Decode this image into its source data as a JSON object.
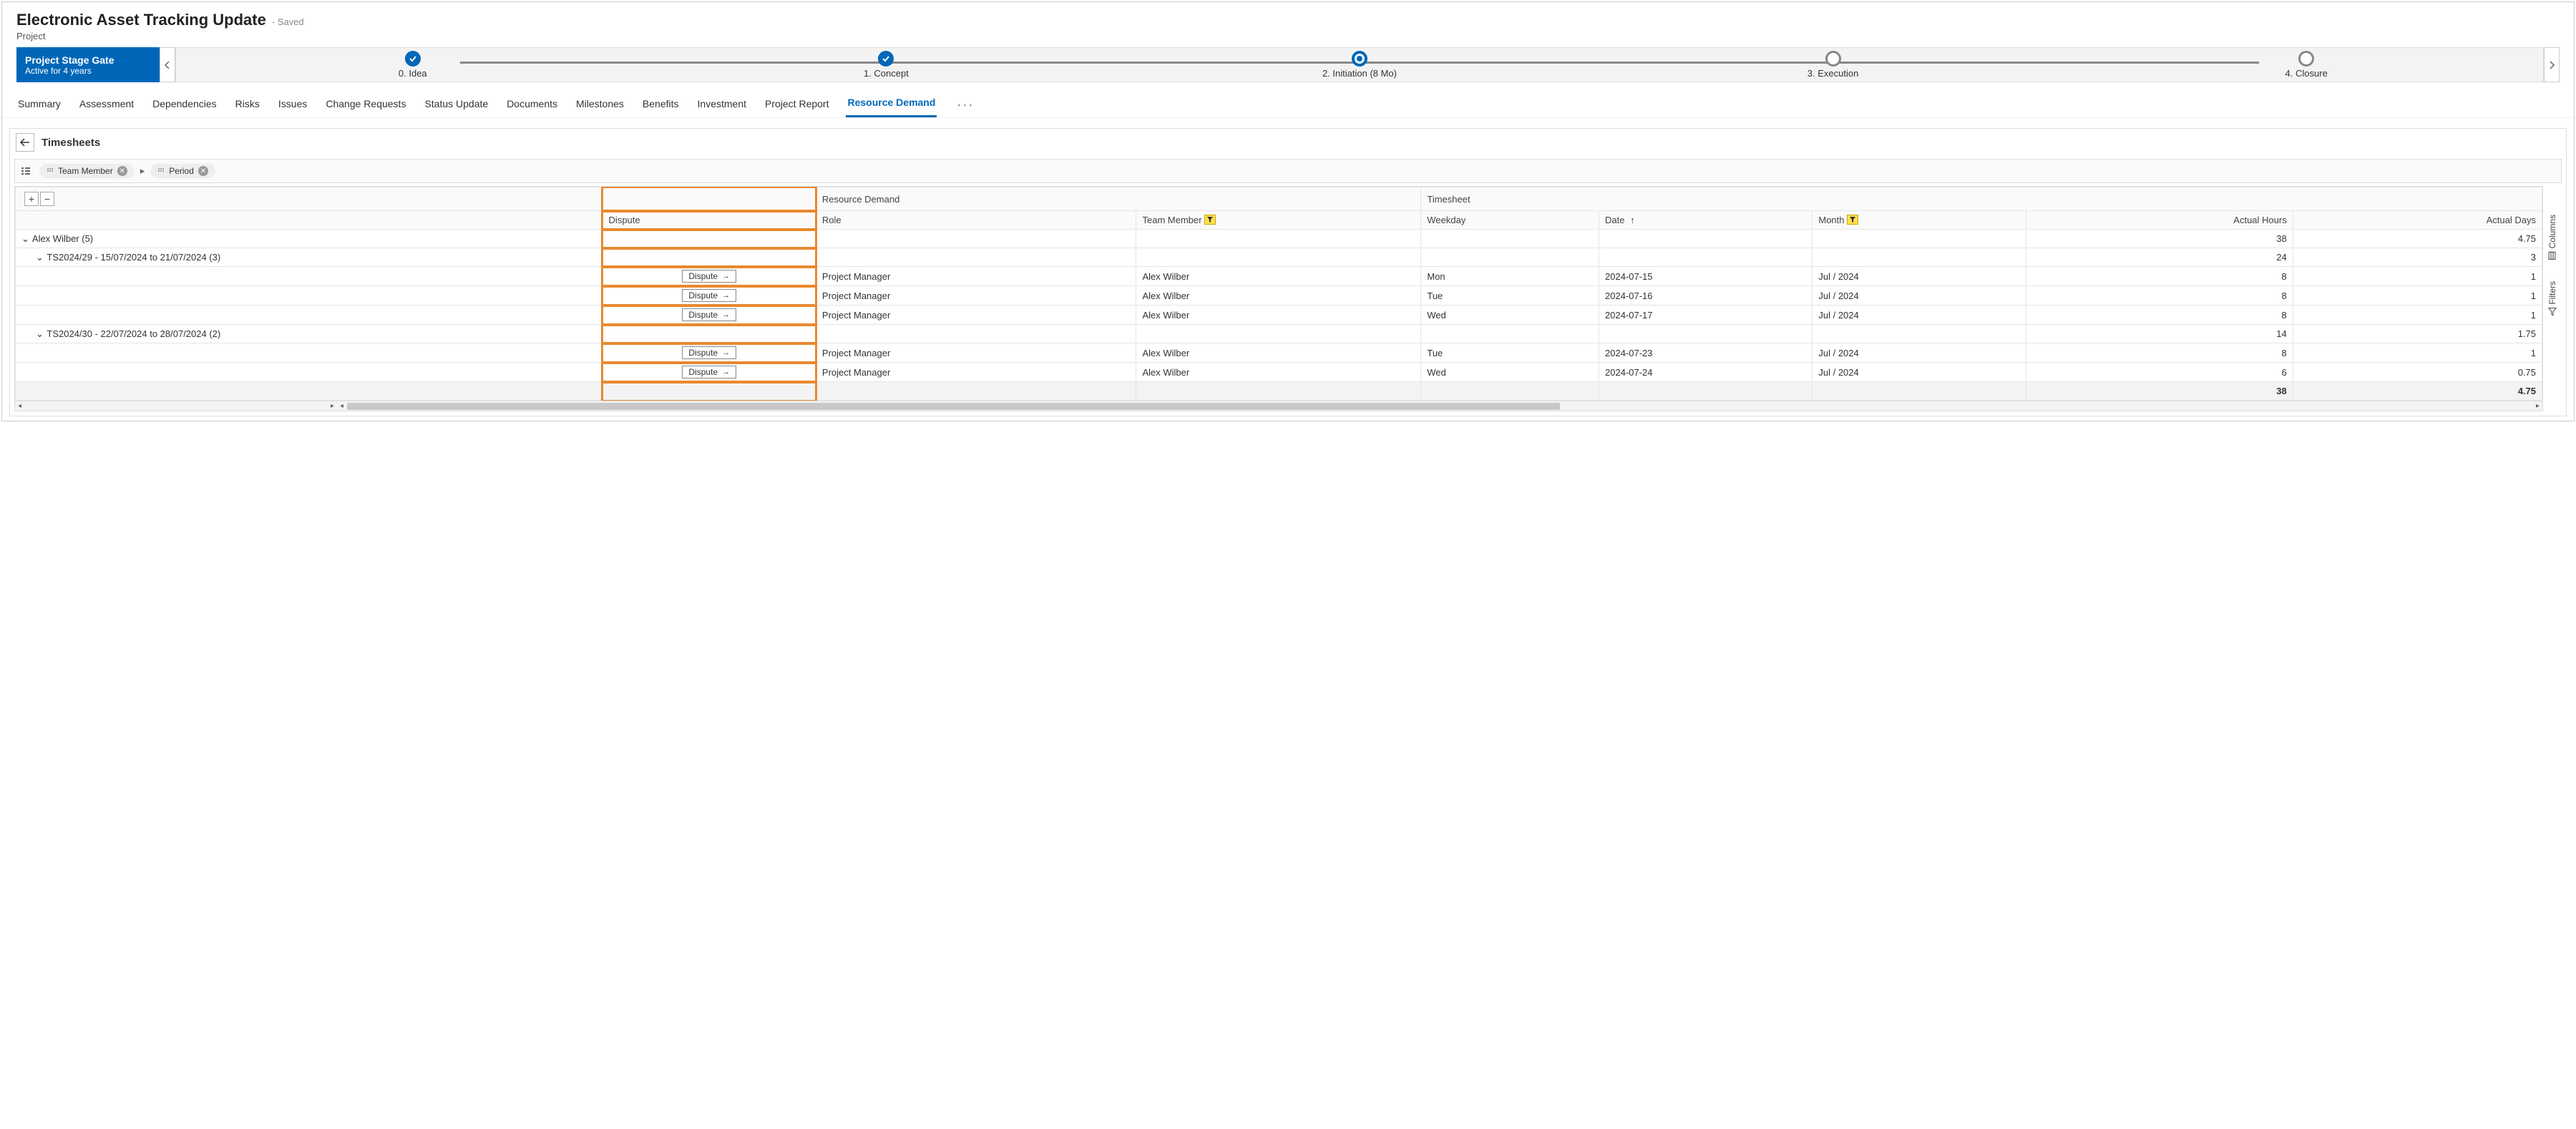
{
  "header": {
    "title": "Electronic Asset Tracking Update",
    "saved_suffix": "- Saved",
    "subtitle": "Project"
  },
  "stage_gate": {
    "label_title": "Project Stage Gate",
    "label_sub": "Active for 4 years",
    "stages": [
      {
        "label": "0. Idea",
        "state": "done"
      },
      {
        "label": "1. Concept",
        "state": "done"
      },
      {
        "label": "2. Initiation  (8 Mo)",
        "state": "current"
      },
      {
        "label": "3. Execution",
        "state": "future"
      },
      {
        "label": "4. Closure",
        "state": "future"
      }
    ]
  },
  "tabs": {
    "items": [
      "Summary",
      "Assessment",
      "Dependencies",
      "Risks",
      "Issues",
      "Change Requests",
      "Status Update",
      "Documents",
      "Milestones",
      "Benefits",
      "Investment",
      "Project Report",
      "Resource Demand"
    ],
    "active_index": 12
  },
  "section": {
    "title": "Timesheets"
  },
  "groupbar": {
    "chips": [
      "Team Member",
      "Period"
    ]
  },
  "grid": {
    "super_headers": {
      "left": "",
      "dispute": "",
      "resource_demand": "Resource Demand",
      "timesheet": "Timesheet"
    },
    "columns": {
      "dispute": "Dispute",
      "role": "Role",
      "team_member": "Team Member",
      "weekday": "Weekday",
      "date": "Date",
      "month": "Month",
      "actual_hours": "Actual Hours",
      "actual_days": "Actual Days"
    },
    "dispute_button_label": "Dispute",
    "groups": [
      {
        "label": "Alex Wilber (5)",
        "actual_hours": "38",
        "actual_days": "4.75",
        "subgroups": [
          {
            "label": "TS2024/29 - 15/07/2024 to 21/07/2024 (3)",
            "actual_hours": "24",
            "actual_days": "3",
            "rows": [
              {
                "role": "Project Manager",
                "member": "Alex Wilber",
                "weekday": "Mon",
                "date": "2024-07-15",
                "month": "Jul / 2024",
                "hours": "8",
                "days": "1"
              },
              {
                "role": "Project Manager",
                "member": "Alex Wilber",
                "weekday": "Tue",
                "date": "2024-07-16",
                "month": "Jul / 2024",
                "hours": "8",
                "days": "1"
              },
              {
                "role": "Project Manager",
                "member": "Alex Wilber",
                "weekday": "Wed",
                "date": "2024-07-17",
                "month": "Jul / 2024",
                "hours": "8",
                "days": "1"
              }
            ]
          },
          {
            "label": "TS2024/30 - 22/07/2024 to 28/07/2024 (2)",
            "actual_hours": "14",
            "actual_days": "1.75",
            "rows": [
              {
                "role": "Project Manager",
                "member": "Alex Wilber",
                "weekday": "Tue",
                "date": "2024-07-23",
                "month": "Jul / 2024",
                "hours": "8",
                "days": "1"
              },
              {
                "role": "Project Manager",
                "member": "Alex Wilber",
                "weekday": "Wed",
                "date": "2024-07-24",
                "month": "Jul / 2024",
                "hours": "6",
                "days": "0.75"
              }
            ]
          }
        ]
      }
    ],
    "totals": {
      "hours": "38",
      "days": "4.75"
    }
  },
  "side_tabs": {
    "columns": "Columns",
    "filters": "Filters"
  }
}
